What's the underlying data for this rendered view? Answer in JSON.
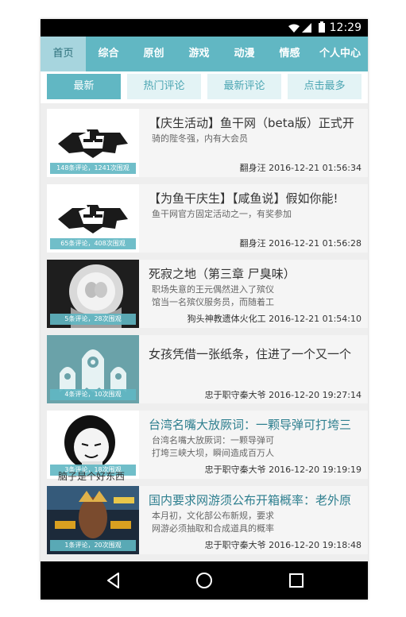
{
  "status_bar": {
    "time": "12:29",
    "icons": [
      "wifi-icon",
      "signal-icon",
      "battery-icon"
    ]
  },
  "top_nav": {
    "tabs": [
      "首页",
      "综合",
      "原创",
      "游戏",
      "动漫",
      "情感",
      "个人中心"
    ],
    "active_index": 0
  },
  "sub_nav": {
    "tabs": [
      "最新",
      "热门评论",
      "最新评论",
      "点击最多"
    ],
    "active_index": 0
  },
  "articles": [
    {
      "title": "【庆生活动】鱼干网（beta版）正式开",
      "summary": "骑的陛冬强，内有大会员",
      "author": "翻身汪",
      "date": "2016-12-21 01:56:34",
      "caption": "148条评论，1241次围观",
      "thumb": "yugan-logo"
    },
    {
      "title": "【为鱼干庆生】【咸鱼说】假如你能!",
      "summary": "鱼干网官方固定活动之一，有奖参加",
      "author": "翻身汪",
      "date": "2016-12-21 01:56:28",
      "caption": "65条评论，408次围观",
      "thumb": "yugan-logo"
    },
    {
      "title": "死寂之地（第三章 尸臭味）",
      "summary": "职场失意的王元偶然进入了殡仪馆当一名殡仪服务员，而随着工作时间的加长，王元见识到",
      "author": "狗头神教遗体火化工",
      "date": "2016-12-21 01:54:10",
      "caption": "5条评论，28次围观",
      "thumb": "flower-face"
    },
    {
      "title": "女孩凭借一张纸条，住进了一个又一个",
      "summary": "",
      "author": "忠于职守秦大爷",
      "date": "2016-12-20 19:27:14",
      "caption": "4条评论，10次围观",
      "thumb": "ghosts"
    },
    {
      "title": "台湾名嘴大放厥词：一颗导弹可打垮三",
      "summary": "台湾名嘴大放厥词：一颗导弹可打垮三峡大坝，瞬间造成百万人死亡",
      "author": "忠于职守秦大爷",
      "date": "2016-12-20 19:19:19",
      "caption": "3条评论，18次围观",
      "thumb": "meme-face",
      "thumb_tip": "脑子是个好东西"
    },
    {
      "title": "国内要求网游须公布开箱概率：老外原",
      "summary": "本月初，文化部公布新规，要求网游必须抽取和合成道具的概率",
      "author": "忠于职守秦大爷",
      "date": "2016-12-20 19:18:48",
      "caption": "1条评论，20次围观",
      "thumb": "game-art"
    }
  ],
  "nav_bar": {
    "buttons": [
      "back-icon",
      "home-icon",
      "recents-icon"
    ]
  },
  "colors": {
    "accent": "#61b7c3",
    "accent_light": "#a7d5de",
    "chip": "#e3f3f5",
    "bg": "#eeeeee",
    "card": "#f5f5f5"
  }
}
